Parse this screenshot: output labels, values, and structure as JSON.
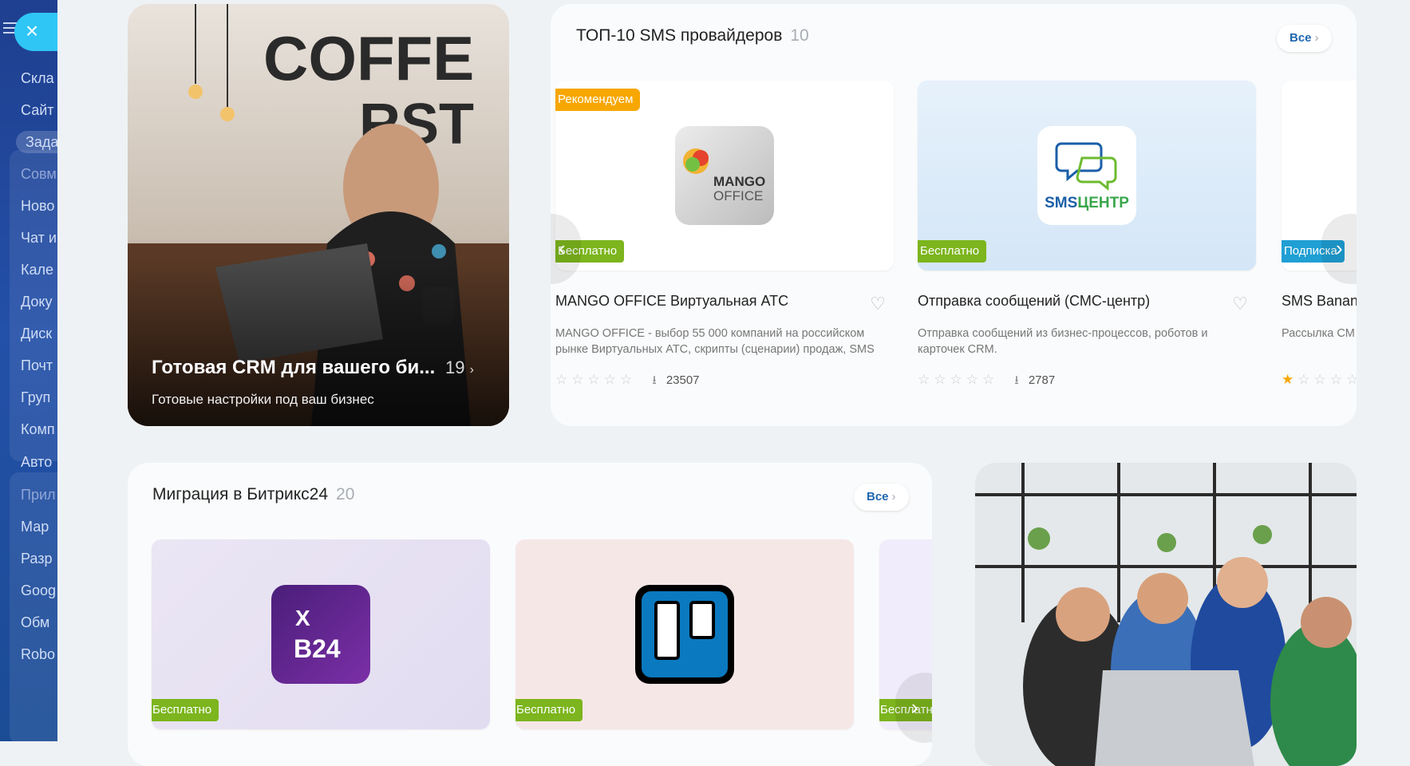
{
  "sidebar": {
    "items": [
      {
        "label": "Скла"
      },
      {
        "label": "Сайт"
      },
      {
        "label": "Зада"
      },
      {
        "label": "Совм"
      },
      {
        "label": "Ново"
      },
      {
        "label": "Чат и"
      },
      {
        "label": "Кале"
      },
      {
        "label": "Доку"
      },
      {
        "label": "Диск"
      },
      {
        "label": "Почт"
      },
      {
        "label": "Груп"
      },
      {
        "label": "Комп"
      },
      {
        "label": "Авто"
      },
      {
        "label": "Прил"
      },
      {
        "label": "Мар"
      },
      {
        "label": "Разр"
      },
      {
        "label": "Goog"
      },
      {
        "label": "Обм"
      },
      {
        "label": "Robo"
      }
    ],
    "close_icon": "×"
  },
  "promo_crm": {
    "title": "Готовая CRM для вашего би...",
    "count": "19",
    "subtitle": "Готовые настройки под ваш бизнес"
  },
  "sms_section": {
    "title": "ТОП-10 SMS провайдеров",
    "count": "10",
    "all_label": "Все",
    "apps": [
      {
        "badge_top": "Рекомендуем",
        "badge": "Бесплатно",
        "name": "MANGO OFFICE Виртуальная АТС",
        "desc": "MANGO OFFICE - выбор 55 000 компаний на российском рынке Виртуальных АТС, скрипты (сценарии) продаж, SMS",
        "rating": 0,
        "downloads": "23507",
        "logo_text1": "MANGO",
        "logo_text2": "OFFICE"
      },
      {
        "badge": "Бесплатно",
        "name": "Отправка сообщений (СМС-центр)",
        "desc": "Отправка сообщений из бизнес-процессов, роботов и карточек CRM.",
        "rating": 0,
        "downloads": "2787",
        "logo_text1": "SMS",
        "logo_text2": "ЦЕНТР"
      },
      {
        "badge": "Подписка",
        "name": "SMS Banan",
        "desc": "Рассылка СМ",
        "rating": 1
      }
    ]
  },
  "migration_section": {
    "title": "Миграция в Битрикс24",
    "count": "20",
    "all_label": "Все",
    "apps": [
      {
        "badge": "Бесплатно",
        "logo_text": "B24",
        "logo_sub": "X"
      },
      {
        "badge": "Бесплатно"
      },
      {
        "badge": "Бесплатно"
      }
    ]
  },
  "colors": {
    "accent": "#2fc6f6",
    "free": "#7cb51d",
    "recommended": "#f7a700",
    "subscription": "#1f9fd4",
    "link": "#2067b0"
  }
}
